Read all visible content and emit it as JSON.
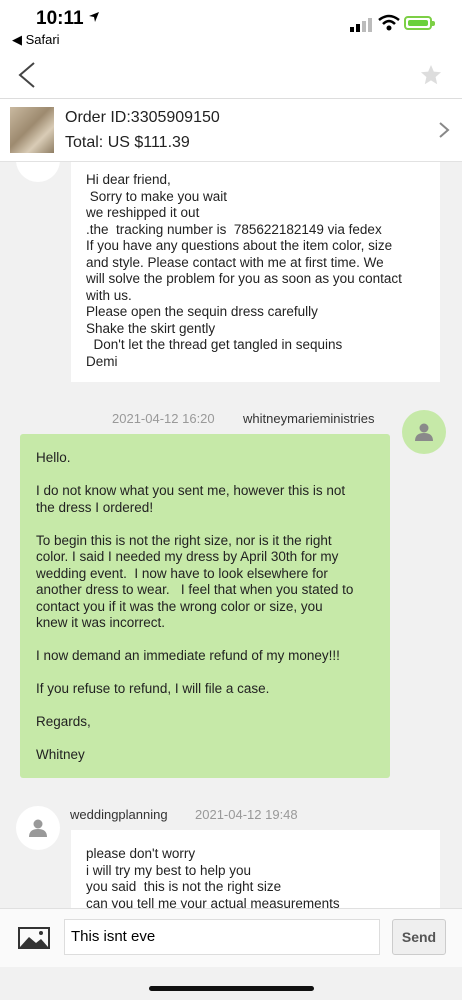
{
  "status_bar": {
    "time": "10:11",
    "back_app": "◀ Safari"
  },
  "order": {
    "id": "Order ID:3305909150",
    "total": "Total:  US $111.39"
  },
  "messages": [
    {
      "lines": [
        "Hi dear friend,",
        " Sorry to make you wait",
        "we reshipped it out",
        ".the  tracking number is  785622182149 via fedex",
        "If you have any questions about the item color, size",
        "and style. Please contact with me at first time. We",
        "will solve the problem for you as soon as you contact",
        "with us.",
        "Please open the sequin dress carefully",
        "Shake the skirt gently",
        "  Don't let the thread get tangled in sequins",
        "Demi"
      ]
    },
    {
      "timestamp": "2021-04-12 16:20",
      "sender": "whitneymarieministries",
      "lines": [
        "Hello.",
        "",
        "I do not know what you sent me, however this is not",
        "the dress I ordered!",
        "",
        "To begin this is not the right size, nor is it the right",
        "color. I said I needed my dress by April 30th for my",
        "wedding event.  I now have to look elsewhere for",
        "another dress to wear.   I feel that when you stated to",
        "contact you if it was the wrong color or size, you",
        "knew it was incorrect.",
        "",
        "I now demand an immediate refund of my money!!!",
        "",
        "If you refuse to refund, I will file a case.",
        "",
        "Regards,",
        "",
        "Whitney"
      ]
    },
    {
      "timestamp": "2021-04-12 19:48",
      "sender": "weddingplanning",
      "lines": [
        "please don't worry",
        "i will try my best to help you",
        "you said  this is not the right size",
        "can you tell me your actual measurements"
      ]
    }
  ],
  "composer": {
    "input_value": "This isnt eve",
    "send_label": "Send"
  }
}
